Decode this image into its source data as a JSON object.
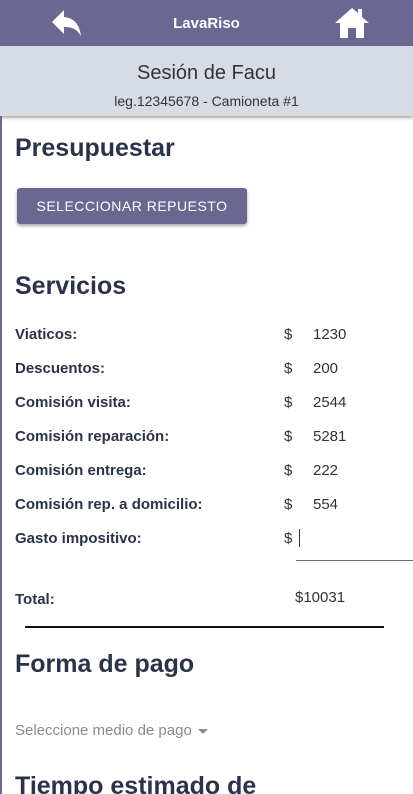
{
  "header": {
    "title": "LavaRiso",
    "back_icon": "arrow-left-icon",
    "home_icon": "home-icon"
  },
  "session": {
    "name": "Sesión de Facu",
    "details": "leg.12345678 - Camioneta #1"
  },
  "presupuestar": {
    "title": "Presupuestar",
    "select_button": "SELECCIONAR REPUESTO"
  },
  "servicios": {
    "title": "Servicios",
    "currency": "$",
    "items": [
      {
        "label": "Viaticos:",
        "value": "1230"
      },
      {
        "label": "Descuentos:",
        "value": "200"
      },
      {
        "label": "Comisión visita:",
        "value": "2544"
      },
      {
        "label": "Comisión reparación:",
        "value": "5281"
      },
      {
        "label": "Comisión entrega:",
        "value": "222"
      },
      {
        "label": "Comisión rep. a domicilio:",
        "value": "554"
      }
    ],
    "tax": {
      "label": "Gasto impositivo:",
      "value": ""
    },
    "total_label": "Total:",
    "total_value": "$10031"
  },
  "forma_pago": {
    "title": "Forma de pago",
    "placeholder": "Seleccione medio de pago"
  },
  "tiempo": {
    "title": "Tiempo estimado de"
  },
  "colors": {
    "primary": "#6a6791",
    "session_bg": "#d6dbe4",
    "heading": "#2b3349"
  }
}
